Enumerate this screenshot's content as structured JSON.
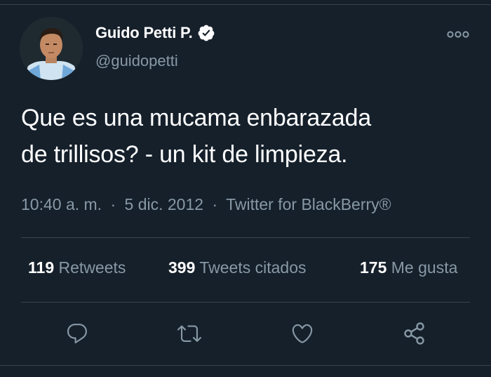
{
  "author": {
    "display_name": "Guido Petti P.",
    "handle": "@guidopetti",
    "verified": true
  },
  "tweet": {
    "text_line1": "Que es una mucama enbarazada",
    "text_line2": "de trillisos? - un kit de limpieza.",
    "time": "10:40 a. m.",
    "separator": "·",
    "date": "5 dic. 2012",
    "source": "Twitter for BlackBerry®"
  },
  "stats": {
    "retweets_count": "119",
    "retweets_label": "Retweets",
    "quotes_count": "399",
    "quotes_label": "Tweets citados",
    "likes_count": "175",
    "likes_label": "Me gusta"
  },
  "actions": [
    {
      "icon": "reply-icon"
    },
    {
      "icon": "retweet-icon"
    },
    {
      "icon": "like-icon"
    },
    {
      "icon": "share-icon"
    }
  ],
  "more_menu": {
    "icon": "more-options-icon"
  },
  "colors": {
    "background": "#15202b",
    "text_primary": "#ffffff",
    "text_secondary": "#8899a6",
    "divider": "#38444d",
    "verified_badge": "#ffffff"
  }
}
